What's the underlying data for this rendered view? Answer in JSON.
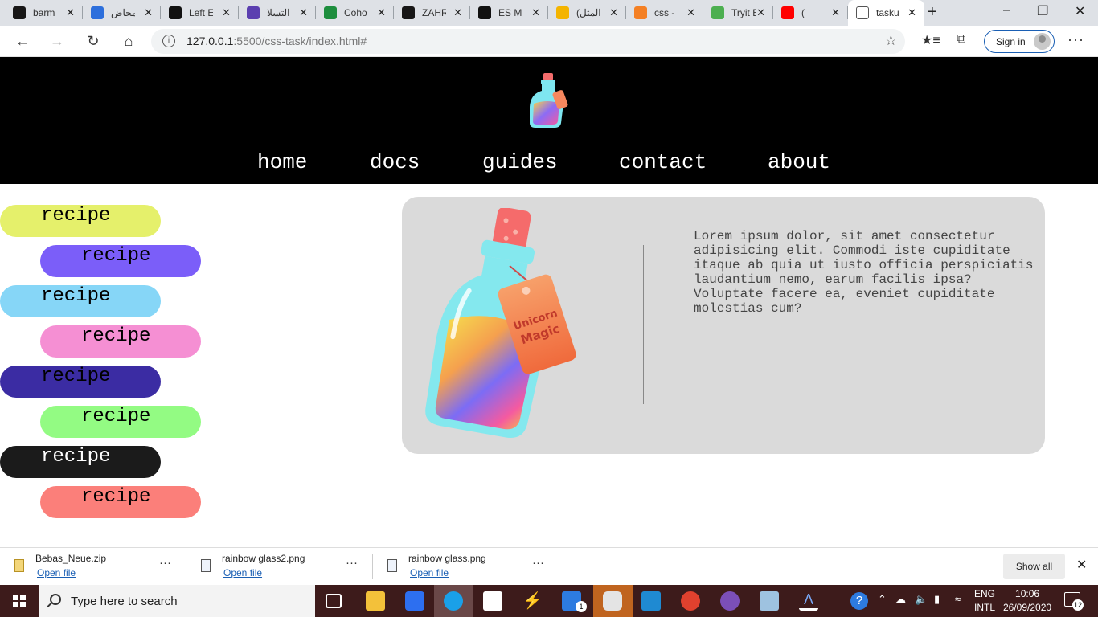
{
  "tabs": [
    {
      "label": "barm",
      "icon": "github-icon",
      "color": "#181717"
    },
    {
      "label": "محاض",
      "icon": "notes-app-icon",
      "color": "#2d6fdc"
    },
    {
      "label": "Left E",
      "icon": "m-logo-icon",
      "color": "#111111"
    },
    {
      "label": "التسلا",
      "icon": "list-app-icon",
      "color": "#5b3fb0"
    },
    {
      "label": "Coho",
      "icon": "green-plus-icon",
      "color": "#1e8e3e"
    },
    {
      "label": "ZAHR",
      "icon": "github-icon",
      "color": "#181717"
    },
    {
      "label": "ES Mo",
      "icon": "medium-icon",
      "color": "#111111"
    },
    {
      "label": "(المثل",
      "icon": "slides-icon",
      "color": "#f4b400"
    },
    {
      "label": "css - (",
      "icon": "stackoverflow-icon",
      "color": "#f48024"
    },
    {
      "label": "Tryit E",
      "icon": "w3schools-icon",
      "color": "#4caf50"
    },
    {
      "label": "(",
      "icon": "youtube-icon",
      "color": "#ff0000"
    },
    {
      "label": "tasku",
      "icon": "page-icon",
      "color": "#ffffff",
      "active": true
    }
  ],
  "address": {
    "url_host": "127.0.0.1",
    "url_path": ":5500/css-task/index.html#",
    "signin_label": "Sign in"
  },
  "site": {
    "nav": [
      "home",
      "docs",
      "guides",
      "contact",
      "about"
    ],
    "recipes": [
      {
        "label": "recipe",
        "bg": "#e5f06b",
        "color": "#000000"
      },
      {
        "label": "recipe",
        "bg": "#7b5ef9",
        "color": "#000000"
      },
      {
        "label": "recipe",
        "bg": "#86d6f7",
        "color": "#000000"
      },
      {
        "label": "recipe",
        "bg": "#f58fd3",
        "color": "#000000"
      },
      {
        "label": "recipe",
        "bg": "#3b2ca3",
        "color": "#000000"
      },
      {
        "label": "recipe",
        "bg": "#93fb83",
        "color": "#000000"
      },
      {
        "label": "recipe",
        "bg": "#1b1b1b",
        "color": "#ffffff"
      },
      {
        "label": "recipe",
        "bg": "#fb7f7a",
        "color": "#000000"
      }
    ],
    "card": {
      "paragraph": "Lorem ipsum dolor, sit amet consectetur adipisicing elit. Commodi iste cupiditate itaque ab quia ut iusto officia perspiciatis laudantium nemo, earum facilis ipsa? Voluptate facere ea, eveniet cupiditate molestias cum?",
      "bottle_tag": [
        "Unicorn",
        "Magic"
      ]
    }
  },
  "downloads": {
    "items": [
      {
        "name": "Bebas_Neue.zip",
        "action": "Open file",
        "icon": "zip-file-icon"
      },
      {
        "name": "rainbow glass2.png",
        "action": "Open file",
        "icon": "image-file-icon"
      },
      {
        "name": "rainbow glass.png",
        "action": "Open file",
        "icon": "image-file-icon"
      }
    ],
    "show_all": "Show all"
  },
  "taskbar": {
    "search_placeholder": "Type here to search",
    "lang_top": "ENG",
    "lang_bottom": "INTL",
    "time": "10:06",
    "date": "26/09/2020",
    "notifications": "12",
    "mail_badge": "1"
  }
}
